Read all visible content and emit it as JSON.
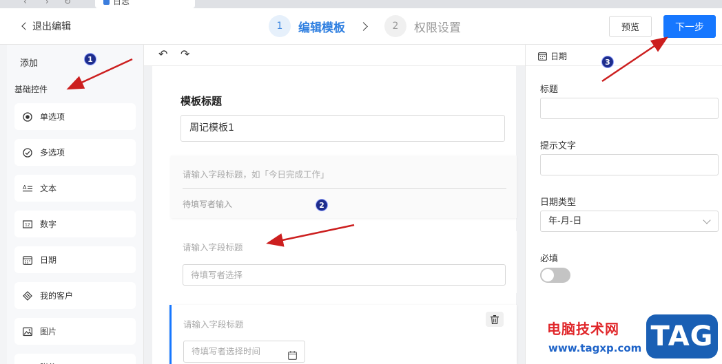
{
  "browser": {
    "tab_title": "日志"
  },
  "header": {
    "back_label": "退出编辑",
    "steps": [
      {
        "num": "1",
        "label": "编辑模板"
      },
      {
        "num": "2",
        "label": "权限设置"
      }
    ],
    "preview_label": "预览",
    "next_label": "下一步"
  },
  "left": {
    "add_label": "添加",
    "section_title": "基础控件",
    "controls": [
      {
        "label": "单选项",
        "icon": "radio-icon"
      },
      {
        "label": "多选项",
        "icon": "check-circle-icon"
      },
      {
        "label": "文本",
        "icon": "text-icon"
      },
      {
        "label": "数字",
        "icon": "number-icon"
      },
      {
        "label": "日期",
        "icon": "calendar-icon"
      },
      {
        "label": "我的客户",
        "icon": "customer-icon"
      },
      {
        "label": "图片",
        "icon": "image-icon"
      },
      {
        "label": "附件",
        "icon": "attachment-icon"
      }
    ]
  },
  "canvas": {
    "template_title_label": "模板标题",
    "template_title_value": "周记模板1",
    "field1_placeholder": "请输入字段标题，如「今日完成工作」",
    "field1_hint": "待填写者输入",
    "field2_placeholder": "请输入字段标题",
    "field2_hint": "待填写者选择",
    "field3_placeholder": "请输入字段标题",
    "field3_hint": "待填写者选择时间"
  },
  "right": {
    "header": "日期",
    "title_label": "标题",
    "title_value": "",
    "hint_label": "提示文字",
    "hint_value": "",
    "date_type_label": "日期类型",
    "date_type_value": "年-月-日",
    "required_label": "必填",
    "required_on": false
  },
  "annotations": {
    "m1": "1",
    "m2": "2",
    "m3": "3",
    "arrow_color": "#cc1f1f"
  },
  "watermark": {
    "site_name": "电脑技术网",
    "url": "www.tagxp.com",
    "logo": "TAG"
  },
  "colors": {
    "primary": "#1677ff",
    "step_active": "#2f7fe0"
  }
}
